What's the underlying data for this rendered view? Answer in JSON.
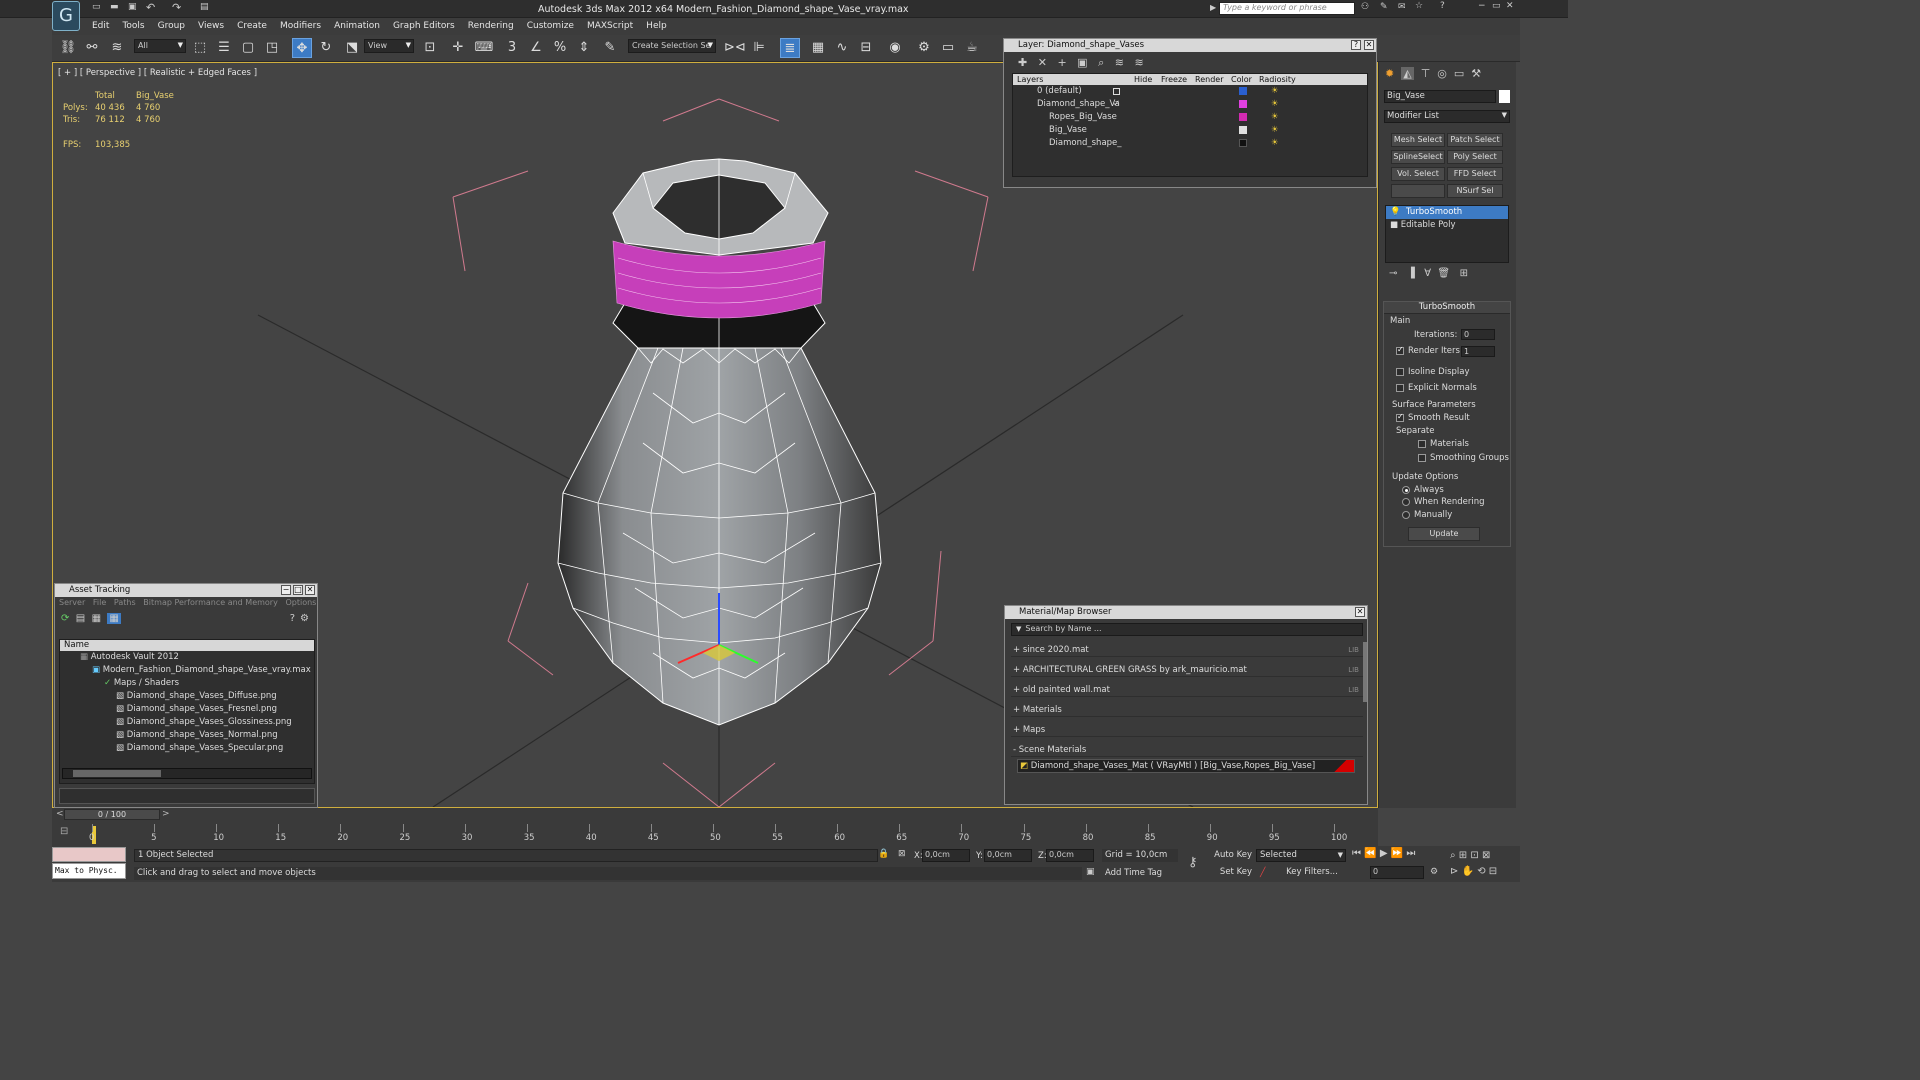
{
  "window": {
    "title": "Autodesk 3ds Max  2012 x64     Modern_Fashion_Diamond_shape_Vase_vray.max",
    "search_placeholder": "Type a keyword or phrase"
  },
  "menu": [
    "Edit",
    "Tools",
    "Group",
    "Views",
    "Create",
    "Modifiers",
    "Animation",
    "Graph Editors",
    "Rendering",
    "Customize",
    "MAXScript",
    "Help"
  ],
  "toolbar": {
    "selection_filter": "All",
    "ref_coord": "View",
    "named_selection": "Create Selection Se"
  },
  "viewport": {
    "label": "[ + ] [ Perspective ] [ Realistic + Edged Faces ]",
    "stats": {
      "col_total": "Total",
      "col_obj": "Big_Vase",
      "polys_label": "Polys:",
      "polys_total": "40 436",
      "polys_obj": "4 760",
      "tris_label": "Tris:",
      "tris_total": "76 112",
      "tris_obj": "4 760",
      "fps_label": "FPS:",
      "fps": "103,385"
    }
  },
  "layer_panel": {
    "title": "Layer: Diamond_shape_Vases",
    "headers": [
      "Layers",
      "Hide",
      "Freeze",
      "Render",
      "Color",
      "Radiosity"
    ],
    "rows": [
      {
        "name": "0 (default)",
        "color": "#2a5fcf"
      },
      {
        "name": "Diamond_shape_Va",
        "color": "#e040e0"
      },
      {
        "name": "Ropes_Big_Vase",
        "color": "#d22ab0"
      },
      {
        "name": "Big_Vase",
        "color": "#e0e0e0"
      },
      {
        "name": "Diamond_shape_",
        "color": "#111111"
      }
    ]
  },
  "asset_panel": {
    "title": "Asset Tracking",
    "menu": [
      "Server",
      "File",
      "Paths",
      "Bitmap Performance and Memory",
      "Options"
    ],
    "header": "Name",
    "rows": [
      "Autodesk Vault 2012",
      "Modern_Fashion_Diamond_shape_Vase_vray.max",
      "Maps / Shaders",
      "Diamond_shape_Vases_Diffuse.png",
      "Diamond_shape_Vases_Fresnel.png",
      "Diamond_shape_Vases_Glossiness.png",
      "Diamond_shape_Vases_Normal.png",
      "Diamond_shape_Vases_Specular.png"
    ]
  },
  "material_browser": {
    "title": "Material/Map Browser",
    "search_placeholder": "Search by Name ...",
    "groups": [
      {
        "label": "+ since 2020.mat",
        "lib": "LIB"
      },
      {
        "label": "+ ARCHITECTURAL GREEN GRASS by ark_mauricio.mat",
        "lib": "LIB"
      },
      {
        "label": "+ old painted wall.mat",
        "lib": "LIB"
      },
      {
        "label": "+ Materials",
        "lib": ""
      },
      {
        "label": "+ Maps",
        "lib": ""
      },
      {
        "label": "- Scene Materials",
        "lib": ""
      }
    ],
    "scene_material": "Diamond_shape_Vases_Mat ( VRayMtl ) [Big_Vase,Ropes_Big_Vase]"
  },
  "command_panel": {
    "object_name": "Big_Vase",
    "modifier_list": "Modifier List",
    "buttons": [
      "Mesh Select",
      "Patch Select",
      "SplineSelect",
      "Poly Select",
      "Vol. Select",
      "FFD Select",
      "",
      "NSurf Sel"
    ],
    "stack": [
      "TurboSmooth",
      "Editable Poly"
    ],
    "rollout_title": "TurboSmooth",
    "main_label": "Main",
    "iterations_label": "Iterations:",
    "iterations": "0",
    "render_iters_label": "Render Iters:",
    "render_iters": "1",
    "isoline": "Isoline Display",
    "explicit": "Explicit Normals",
    "surface_params": "Surface Parameters",
    "smooth_result": "Smooth Result",
    "separate": "Separate",
    "materials": "Materials",
    "smoothing_groups": "Smoothing Groups",
    "update_options": "Update Options",
    "always": "Always",
    "when_rendering": "When Rendering",
    "manually": "Manually",
    "update": "Update"
  },
  "timeline": {
    "frame": "0 / 100",
    "ticks": [
      "0",
      "5",
      "10",
      "15",
      "20",
      "25",
      "30",
      "35",
      "40",
      "45",
      "50",
      "55",
      "60",
      "65",
      "70",
      "75",
      "80",
      "85",
      "90",
      "95",
      "100"
    ]
  },
  "status": {
    "maxscript": "Max to Physc.",
    "selected": "1 Object Selected",
    "prompt": "Click and drag to select and move objects",
    "x_label": "X:",
    "x": "0,0cm",
    "y_label": "Y:",
    "y": "0,0cm",
    "z_label": "Z:",
    "z": "0,0cm",
    "grid": "Grid = 10,0cm",
    "add_time_tag": "Add Time Tag",
    "auto_key": "Auto Key",
    "set_key": "Set Key",
    "key_mode": "Selected",
    "key_filters": "Key Filters...",
    "frame_field": "0"
  },
  "colors": {
    "accent": "#3d7bc4",
    "rope": "#d23cc8",
    "viewport_border": "#cfae3e"
  }
}
